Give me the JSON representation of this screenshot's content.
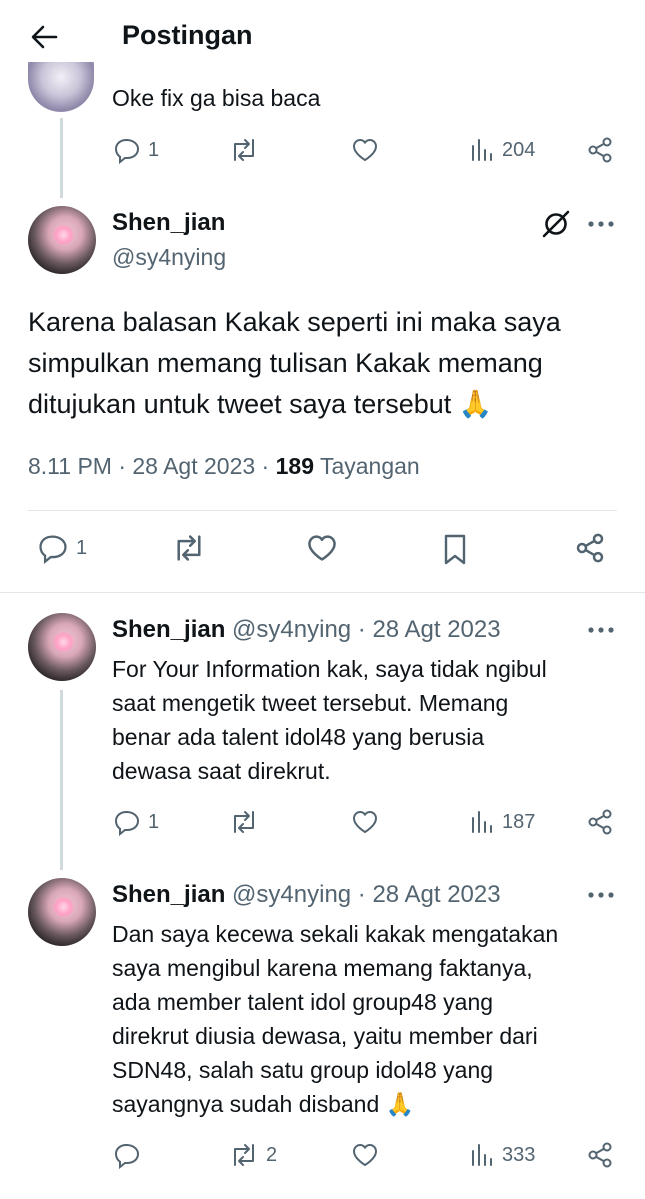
{
  "header": {
    "title": "Postingan"
  },
  "parent_reply": {
    "text": "Oke fix ga bisa baca",
    "replies": "1",
    "views": "204"
  },
  "main_post": {
    "name": "Shen_jian",
    "handle": "@sy4nying",
    "text_lines": [
      "Karena balasan Kakak seperti ini maka saya",
      "simpulkan memang tulisan Kakak memang",
      "ditujukan untuk tweet saya tersebut 🙏"
    ],
    "time": "8.11 PM · 28 Agt 2023 · ",
    "views_count": "189",
    "views_label": " Tayangan",
    "replies": "1"
  },
  "reply1": {
    "name": "Shen_jian",
    "meta": "@sy4nying · 28 Agt 2023",
    "text_lines": [
      "For Your Information kak, saya tidak ngibul",
      "saat mengetik tweet tersebut. Memang",
      "benar ada talent idol48 yang berusia",
      "dewasa saat direkrut."
    ],
    "replies": "1",
    "views": "187"
  },
  "reply2": {
    "name": "Shen_jian",
    "meta": "@sy4nying · 28 Agt 2023",
    "text_lines": [
      "Dan saya kecewa sekali kakak mengatakan",
      "saya mengibul karena memang faktanya,",
      "ada member talent idol group48 yang",
      "direkrut diusia dewasa, yaitu member dari",
      "SDN48, salah satu group idol48 yang",
      "sayangnya sudah disband 🙏"
    ],
    "reposts": "2",
    "views": "333"
  },
  "icons": {
    "back": "arrow-left-icon",
    "grok": "grok-icon",
    "more": "more-dots-icon",
    "reply": "reply-icon",
    "repost": "repost-icon",
    "like": "like-icon",
    "views": "views-icon",
    "share": "share-icon",
    "bookmark": "bookmark-icon"
  }
}
